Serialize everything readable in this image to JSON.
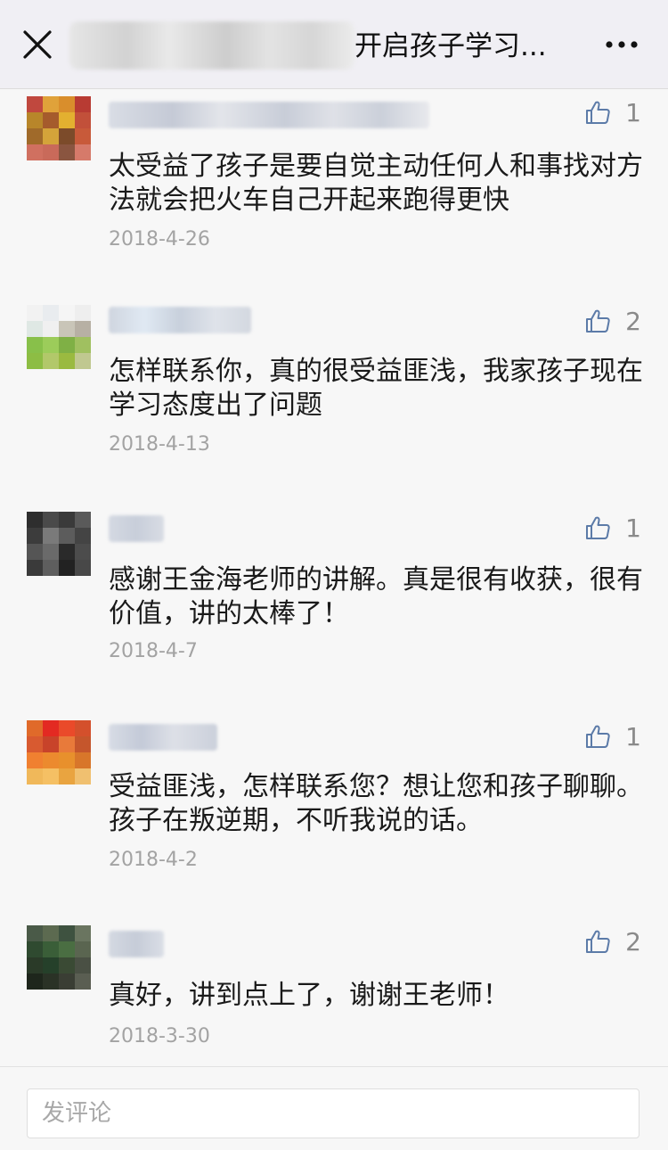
{
  "header": {
    "title": "开启孩子学习...",
    "close_icon": "close-icon",
    "more_icon": "more-icon"
  },
  "comments": [
    {
      "text": "太受益了孩子是要自觉主动任何人和事找对方法就会把火车自己开起来跑得更快",
      "date": "2018-4-26",
      "likes": "1",
      "avatar_colors": [
        "#c0483e",
        "#e0a23a",
        "#d98e2c",
        "#b83b33",
        "#b8862a",
        "#a55b2c",
        "#e3b030",
        "#c2503a",
        "#a06a2a",
        "#d4a43a",
        "#7c4b2a",
        "#c85a3a",
        "#d07060",
        "#c96a5a",
        "#8a5540",
        "#d67a6a"
      ]
    },
    {
      "text": "怎样联系你，真的很受益匪浅，我家孩子现在学习态度出了问题",
      "date": "2018-4-13",
      "likes": "2",
      "avatar_colors": [
        "#f2f2f2",
        "#e9ecef",
        "#f5f5f5",
        "#eeeeee",
        "#dfe8e4",
        "#f0f0f0",
        "#c9c5b8",
        "#b7b0a4",
        "#88c04a",
        "#9ccc5a",
        "#7fb045",
        "#a0c060",
        "#8dbd44",
        "#b2c86a",
        "#9aba40",
        "#c0c890"
      ]
    },
    {
      "text": "感谢王金海老师的讲解。真是很有收获，很有价值，讲的太棒了！",
      "date": "2018-4-7",
      "likes": "1",
      "avatar_colors": [
        "#2e2e2e",
        "#4a4a4a",
        "#3a3a3a",
        "#5a5a5a",
        "#3c3c3c",
        "#7a7a7a",
        "#5c5c5c",
        "#444444",
        "#555555",
        "#6a6a6a",
        "#2a2a2a",
        "#4c4c4c",
        "#3a3a3a",
        "#5e5e5e",
        "#222222",
        "#484848"
      ]
    },
    {
      "text": "受益匪浅，怎样联系您？想让您和孩子聊聊。孩子在叛逆期，不听我说的话。",
      "date": "2018-4-2",
      "likes": "1",
      "avatar_colors": [
        "#e06a2a",
        "#e32a22",
        "#ea4a2a",
        "#d4502c",
        "#d85a30",
        "#c8432a",
        "#e87a3a",
        "#c5562c",
        "#f08030",
        "#ec8a2e",
        "#e8902c",
        "#d8762a",
        "#f0b85a",
        "#f5c064",
        "#e9a440",
        "#f0c070"
      ]
    },
    {
      "text": "真好，讲到点上了，谢谢王老师！",
      "date": "2018-3-30",
      "likes": "2",
      "avatar_colors": [
        "#4a5a48",
        "#5c6a50",
        "#3e5240",
        "#6a7560",
        "#2f4a30",
        "#3a5e38",
        "#4a6e42",
        "#5a6550",
        "#2a3a28",
        "#25402a",
        "#3a4a34",
        "#4a5044",
        "#1e261c",
        "#2a3226",
        "#3a3e34",
        "#5a5e52"
      ]
    }
  ],
  "footer": {
    "input_placeholder": "发评论"
  },
  "colors": {
    "icon_blue": "#5c7ba8",
    "date_gray": "#a3a3a3",
    "text_black": "#1a1a1a"
  }
}
